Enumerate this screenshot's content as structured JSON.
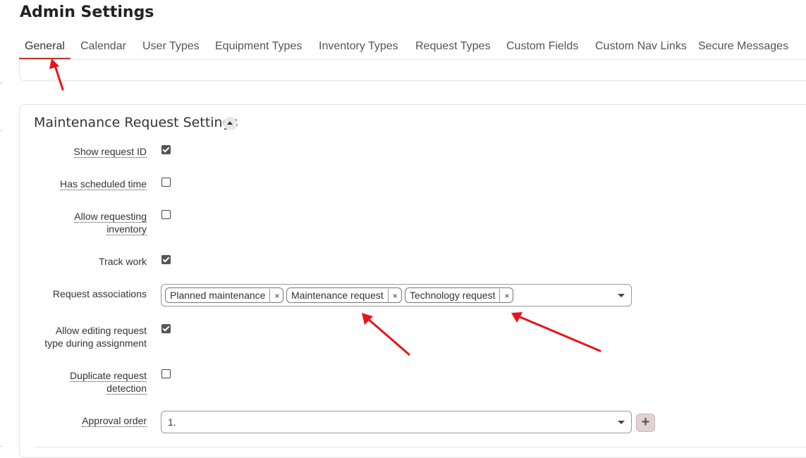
{
  "page": {
    "title": "Admin Settings"
  },
  "tabs": [
    {
      "label": "General",
      "active": true
    },
    {
      "label": "Calendar"
    },
    {
      "label": "User Types"
    },
    {
      "label": "Equipment Types"
    },
    {
      "label": "Inventory Types"
    },
    {
      "label": "Request Types"
    },
    {
      "label": "Custom Fields"
    },
    {
      "label": "Custom Nav Links"
    },
    {
      "label": "Secure Messages"
    }
  ],
  "section": {
    "title": "Maintenance Request Settings",
    "fields": {
      "show_request_id": {
        "label": "Show request ID",
        "checked": true
      },
      "has_scheduled_time": {
        "label": "Has scheduled time",
        "checked": false
      },
      "allow_requesting_inventory": {
        "label_line1": "Allow requesting",
        "label_line2": "inventory",
        "checked": false
      },
      "track_work": {
        "label": "Track work",
        "checked": true
      },
      "request_associations": {
        "label": "Request associations",
        "chips": [
          "Planned maintenance",
          "Maintenance request",
          "Technology request"
        ],
        "remove_glyph": "×"
      },
      "allow_editing_request_type": {
        "label_line1": "Allow editing request",
        "label_line2": "type during assignment",
        "checked": true
      },
      "duplicate_request_detection": {
        "label_line1": "Duplicate request",
        "label_line2": "detection",
        "checked": false
      },
      "approval_order": {
        "label": "Approval order",
        "value": "1.",
        "add_glyph": "+"
      }
    }
  },
  "colors": {
    "tab_active_underline": "#c0392b",
    "annotation_arrow": "#e8141c"
  }
}
